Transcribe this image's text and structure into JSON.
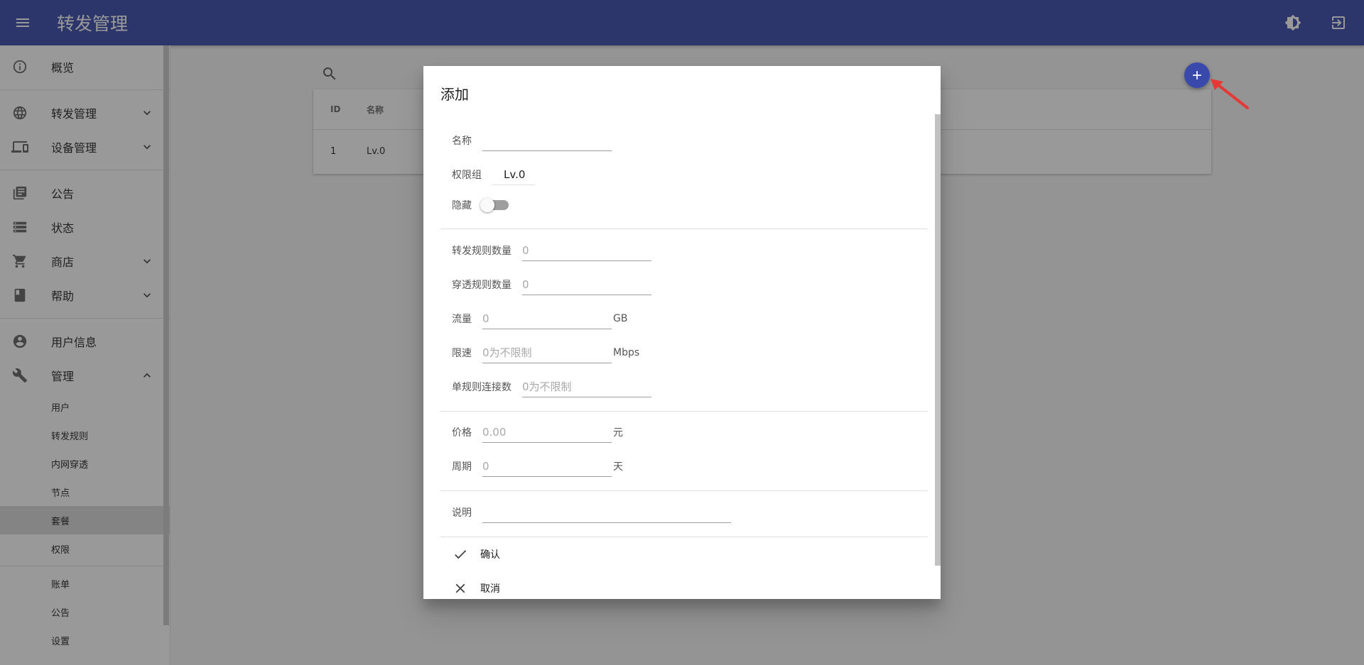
{
  "appbar": {
    "title": "转发管理",
    "icons": [
      "menu-icon",
      "brightness-icon",
      "logout-icon"
    ]
  },
  "sidebar": {
    "overview": "概览",
    "forward": "转发管理",
    "devices": "设备管理",
    "notice": "公告",
    "status": "状态",
    "shop": "商店",
    "help": "帮助",
    "user_info": "用户信息",
    "manage": "管理",
    "manage_items": [
      "用户",
      "转发规则",
      "内网穿透",
      "节点",
      "套餐",
      "权限"
    ],
    "active_item": "套餐",
    "extra_items": [
      "账单",
      "公告",
      "设置"
    ]
  },
  "table": {
    "headers": [
      "ID",
      "名称"
    ],
    "rows": [
      [
        "1",
        "Lv.0"
      ]
    ]
  },
  "dialog": {
    "title": "添加",
    "name_label": "名称",
    "name_value": "",
    "group_label": "权限组",
    "group_value": "Lv.0",
    "hidden_label": "隐藏",
    "hidden_on": false,
    "forward_rules_label": "转发规则数量",
    "forward_rules_placeholder": "0",
    "tunnel_rules_label": "穿透规则数量",
    "tunnel_rules_placeholder": "0",
    "traffic_label": "流量",
    "traffic_placeholder": "0",
    "traffic_unit": "GB",
    "speed_label": "限速",
    "speed_placeholder": "0为不限制",
    "speed_unit": "Mbps",
    "conn_label": "单规则连接数",
    "conn_placeholder": "0为不限制",
    "price_label": "价格",
    "price_placeholder": "0.00",
    "price_unit": "元",
    "period_label": "周期",
    "period_placeholder": "0",
    "period_unit": "天",
    "desc_label": "说明",
    "desc_value": "",
    "confirm": "确认",
    "cancel": "取消"
  },
  "colors": {
    "primary": "#3949ab",
    "arrow": "#e53935"
  }
}
